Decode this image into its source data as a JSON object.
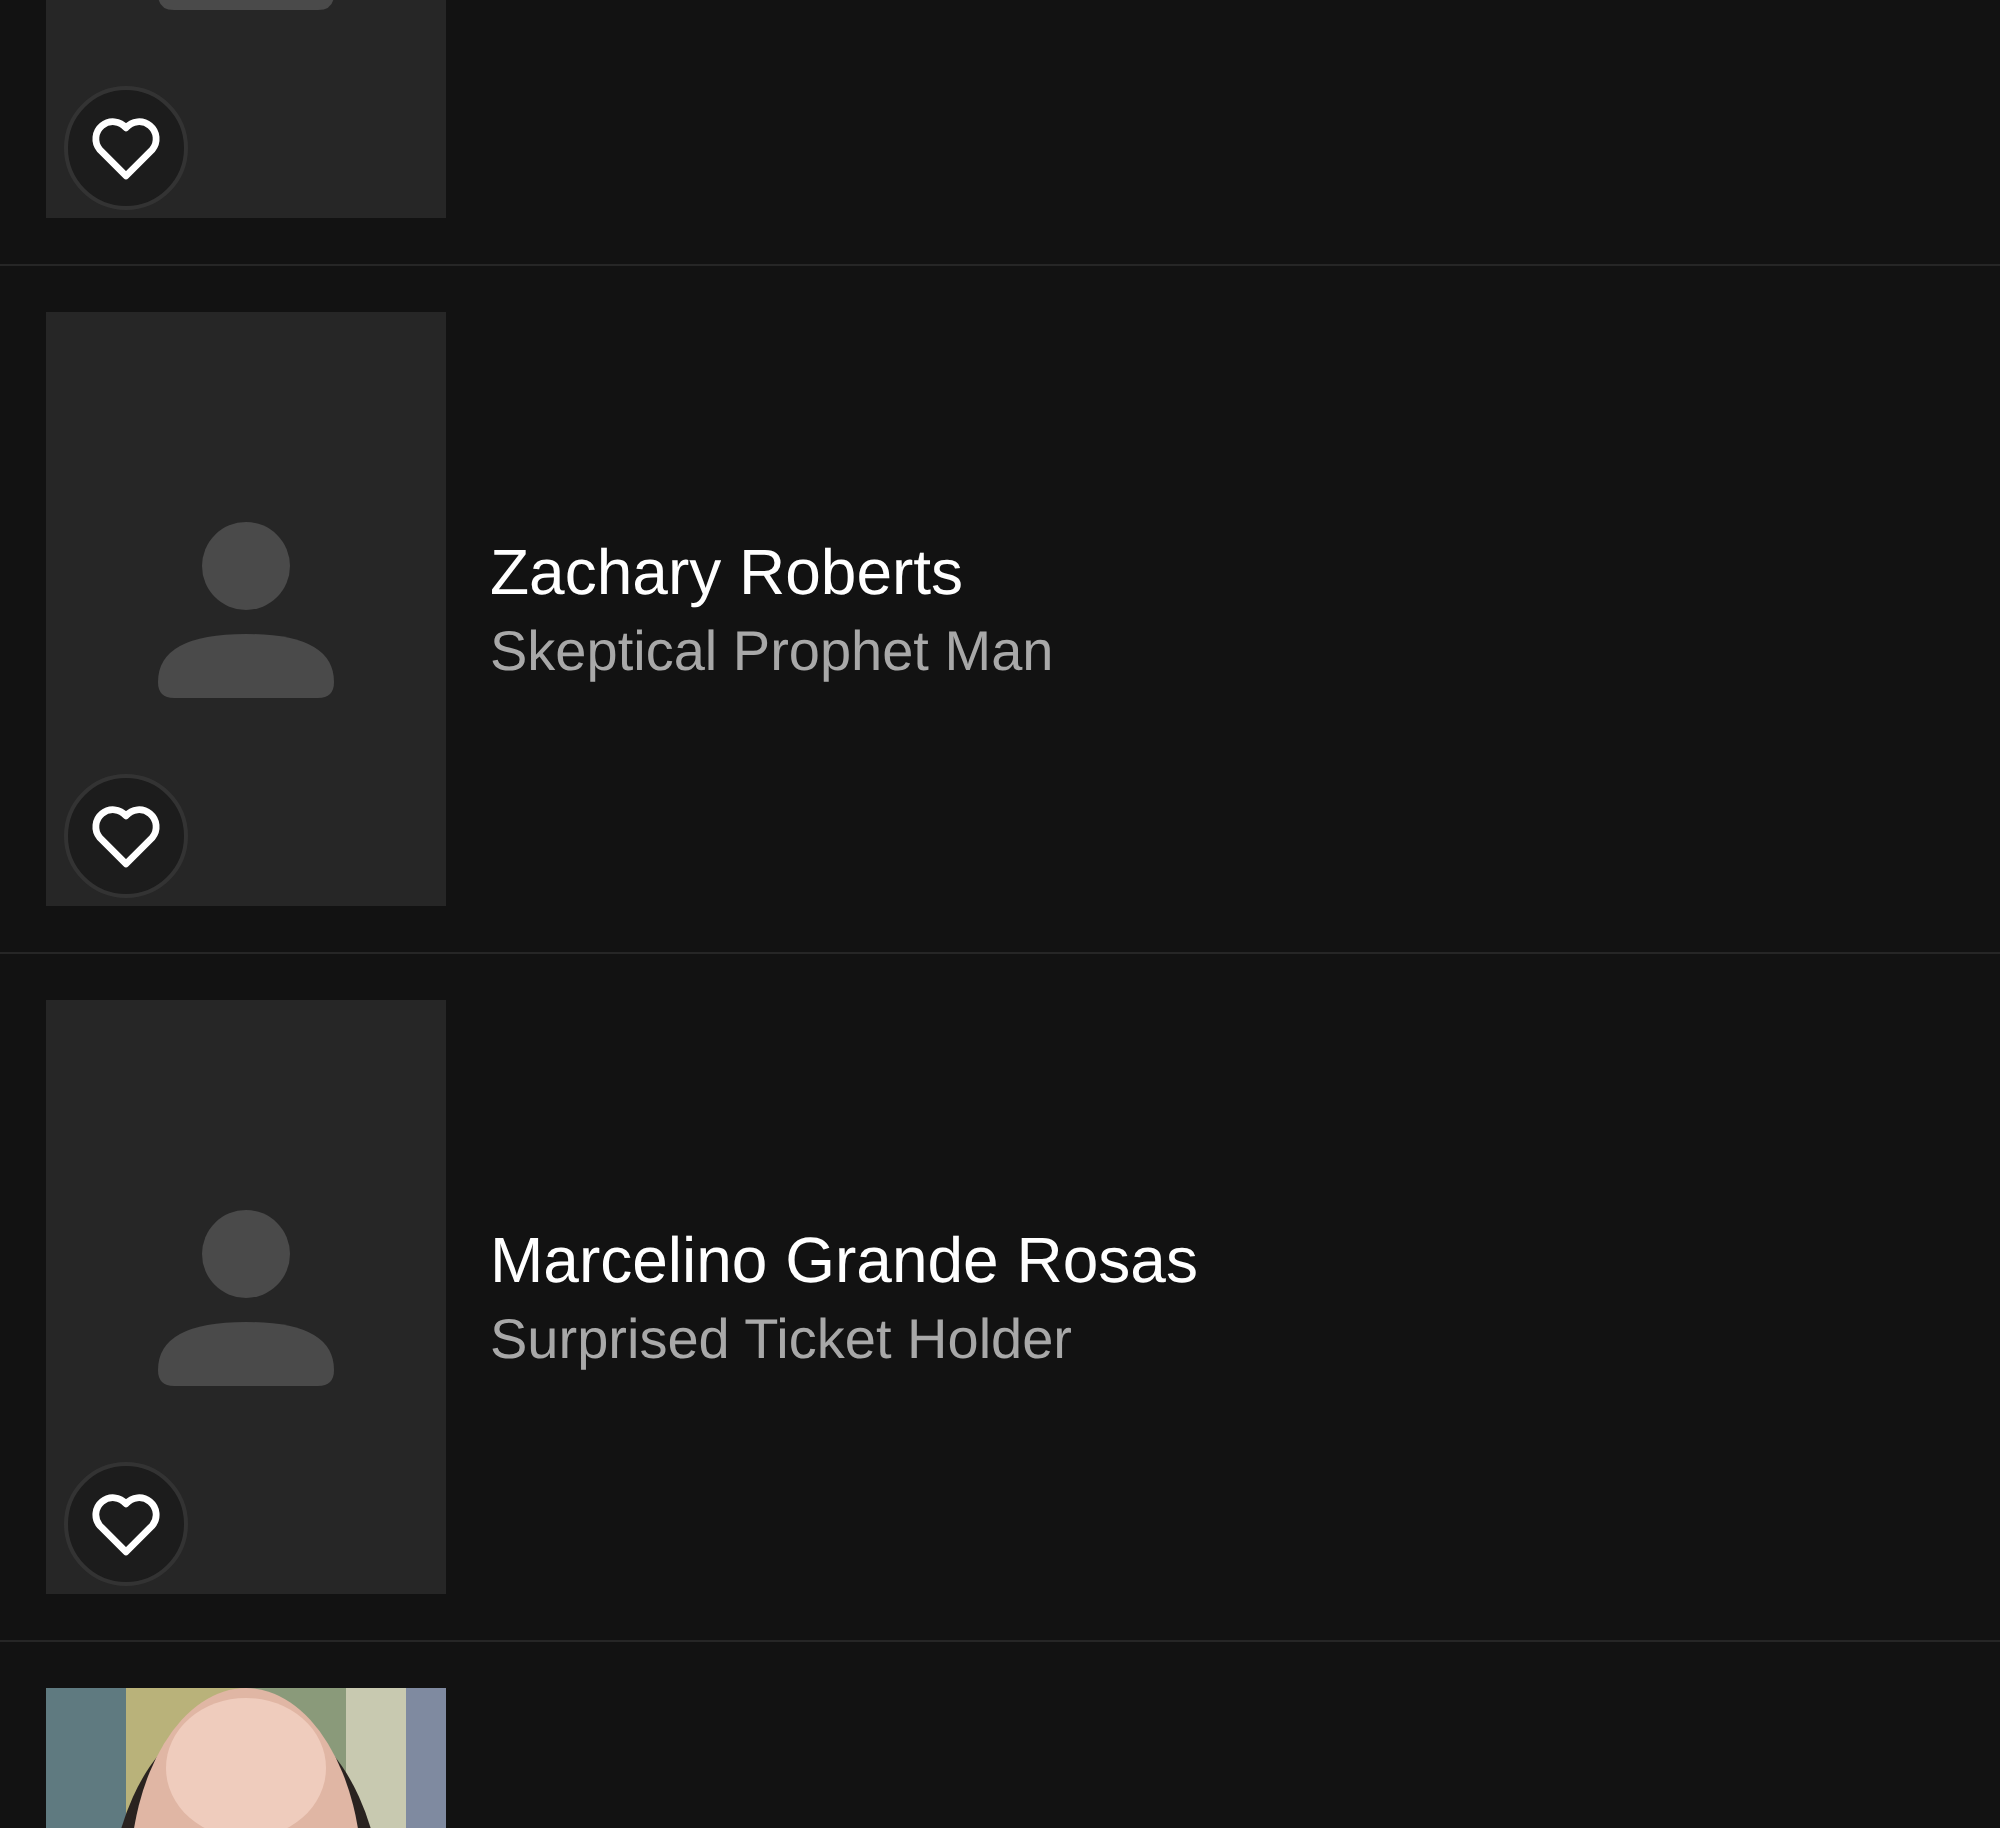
{
  "cast": [
    {
      "kind": "placeholder",
      "favorite": false
    },
    {
      "kind": "placeholder",
      "favorite": false,
      "name": "Zachary Roberts",
      "role": "Skeptical Prophet Man"
    },
    {
      "kind": "placeholder",
      "favorite": false,
      "name": "Marcelino Grande Rosas",
      "role": "Surprised Ticket Holder"
    },
    {
      "kind": "picture"
    }
  ]
}
